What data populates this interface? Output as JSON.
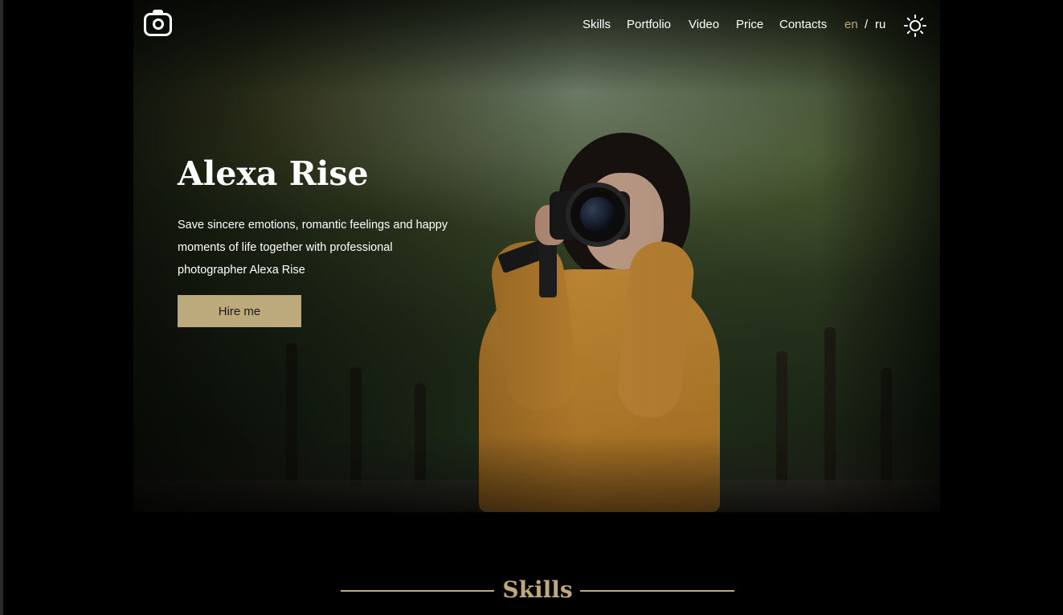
{
  "nav": {
    "logo_icon": "camera-icon",
    "links": [
      "Skills",
      "Portfolio",
      "Video",
      "Price",
      "Contacts"
    ],
    "lang_en": "en",
    "lang_sep": "/",
    "lang_ru": "ru",
    "theme_icon": "sun-icon"
  },
  "hero": {
    "title": "Alexa Rise",
    "text": "Save sincere emotions, romantic feelings and happy moments of life together with professional photographer Alexa Rise",
    "button": "Hire me"
  },
  "skills": {
    "title": "Skills"
  },
  "colors": {
    "accent": "#bdaa7c",
    "background": "#000000",
    "text": "#ffffff"
  }
}
